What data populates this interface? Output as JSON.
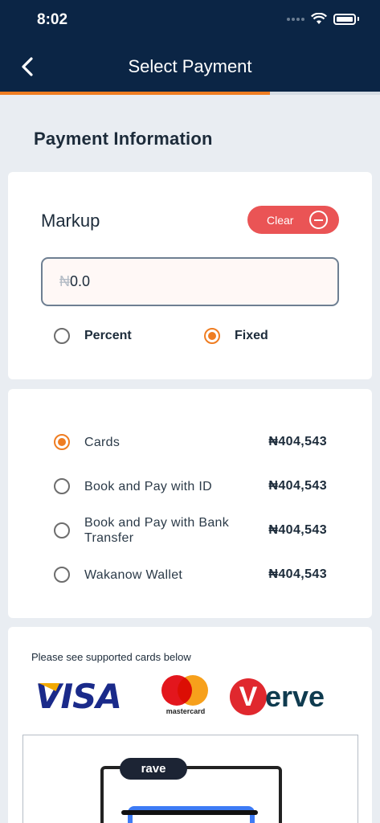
{
  "status_bar": {
    "time": "8:02"
  },
  "nav": {
    "title": "Select Payment",
    "progress_fraction": 0.71
  },
  "section_title": "Payment Information",
  "markup": {
    "label": "Markup",
    "clear_label": "Clear",
    "currency_symbol": "₦",
    "input_value": "0.0",
    "options": [
      {
        "label": "Percent",
        "selected": false
      },
      {
        "label": "Fixed",
        "selected": true
      }
    ]
  },
  "payment_methods": [
    {
      "label": "Cards",
      "amount": "₦404,543",
      "selected": true
    },
    {
      "label": "Book and Pay with ID",
      "amount": "₦404,543",
      "selected": false
    },
    {
      "label": "Book and Pay with Bank Transfer",
      "amount": "₦404,543",
      "selected": false
    },
    {
      "label": "Wakanow Wallet",
      "amount": "₦404,543",
      "selected": false
    }
  ],
  "supported_cards": {
    "note": "Please see supported cards below",
    "logos": [
      "VISA",
      "mastercard",
      "Verve"
    ]
  },
  "rave": {
    "badge": "rave"
  },
  "colors": {
    "navy": "#0b2545",
    "accent": "#ef7d22",
    "danger": "#ea5455"
  }
}
